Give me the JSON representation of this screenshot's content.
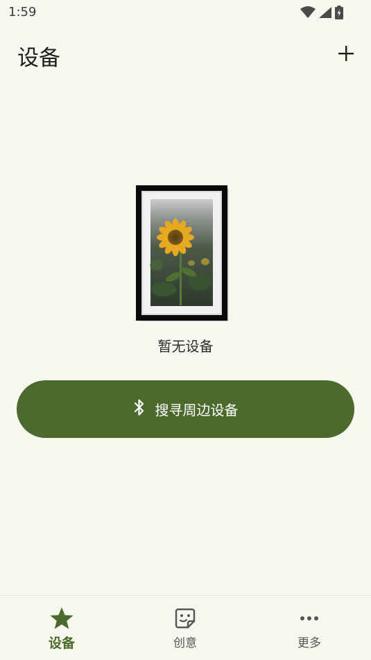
{
  "status_bar": {
    "time": "1:59"
  },
  "header": {
    "title": "设备",
    "add_icon": "plus-icon"
  },
  "empty_state": {
    "message": "暂无设备",
    "illustration": "photo-frame-sunflower"
  },
  "search_button": {
    "label": "搜寻周边设备",
    "icon": "bluetooth-icon"
  },
  "bottom_nav": {
    "items": [
      {
        "label": "设备",
        "icon": "star-icon",
        "active": true
      },
      {
        "label": "创意",
        "icon": "sticker-icon",
        "active": false
      },
      {
        "label": "更多",
        "icon": "more-horizontal-icon",
        "active": false
      }
    ]
  },
  "colors": {
    "accent": "#4c6a2d",
    "background": "#f6f7ee",
    "text": "#1d1f1a"
  }
}
